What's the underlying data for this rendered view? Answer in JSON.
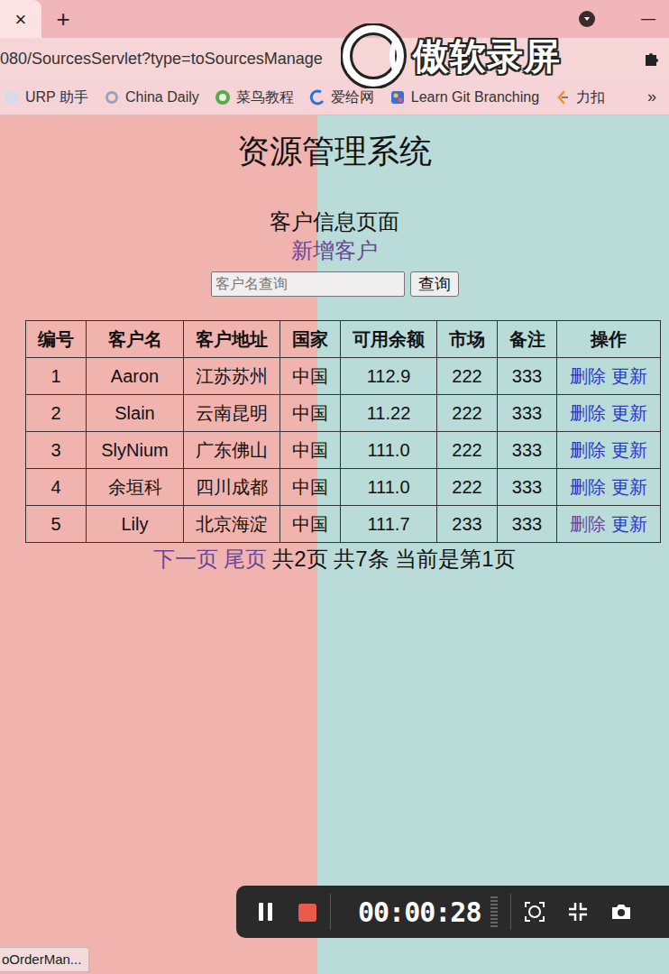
{
  "browser": {
    "tab_close": "×",
    "new_tab": "+",
    "minimize": "—",
    "address": "080/SourcesServlet?type=toSourcesManage",
    "bookmarks": [
      {
        "label": "URP 助手"
      },
      {
        "label": "China Daily"
      },
      {
        "label": "菜鸟教程"
      },
      {
        "label": "爱给网"
      },
      {
        "label": "Learn Git Branching"
      },
      {
        "label": "力扣"
      }
    ],
    "more": "»"
  },
  "watermark": {
    "text": "傲软录屏"
  },
  "page": {
    "title": "资源管理系统",
    "subtitle": "客户信息页面",
    "add_link": {
      "label": "新增客户",
      "visited": true
    }
  },
  "search": {
    "placeholder": "客户名查询",
    "button": "查询"
  },
  "table": {
    "columns": [
      "编号",
      "客户名",
      "客户地址",
      "国家",
      "可用余额",
      "市场",
      "备注",
      "操作"
    ],
    "rows": [
      {
        "cells": [
          "1",
          "Aaron",
          "江苏苏州",
          "中国",
          "112.9",
          "222",
          "333"
        ],
        "actions": [
          {
            "label": "删除",
            "visited": false
          },
          {
            "label": "更新",
            "visited": false
          }
        ]
      },
      {
        "cells": [
          "2",
          "Slain",
          "云南昆明",
          "中国",
          "11.22",
          "222",
          "333"
        ],
        "actions": [
          {
            "label": "删除",
            "visited": false
          },
          {
            "label": "更新",
            "visited": false
          }
        ]
      },
      {
        "cells": [
          "3",
          "SlyNium",
          "广东佛山",
          "中国",
          "111.0",
          "222",
          "333"
        ],
        "actions": [
          {
            "label": "删除",
            "visited": false
          },
          {
            "label": "更新",
            "visited": false
          }
        ]
      },
      {
        "cells": [
          "4",
          "余垣科",
          "四川成都",
          "中国",
          "111.0",
          "222",
          "333"
        ],
        "actions": [
          {
            "label": "删除",
            "visited": false
          },
          {
            "label": "更新",
            "visited": false
          }
        ]
      },
      {
        "cells": [
          "5",
          "Lily",
          "北京海淀",
          "中国",
          "111.7",
          "233",
          "333"
        ],
        "actions": [
          {
            "label": "删除",
            "visited": true
          },
          {
            "label": "更新",
            "visited": false
          }
        ]
      }
    ]
  },
  "pagination": {
    "links": [
      {
        "label": "下一页",
        "visited": true
      },
      {
        "label": "尾页",
        "visited": true
      }
    ],
    "info": "共2页 共7条 当前是第1页"
  },
  "recorder": {
    "time": "00:00:28"
  },
  "status_bar": {
    "text": "oOrderMan..."
  }
}
